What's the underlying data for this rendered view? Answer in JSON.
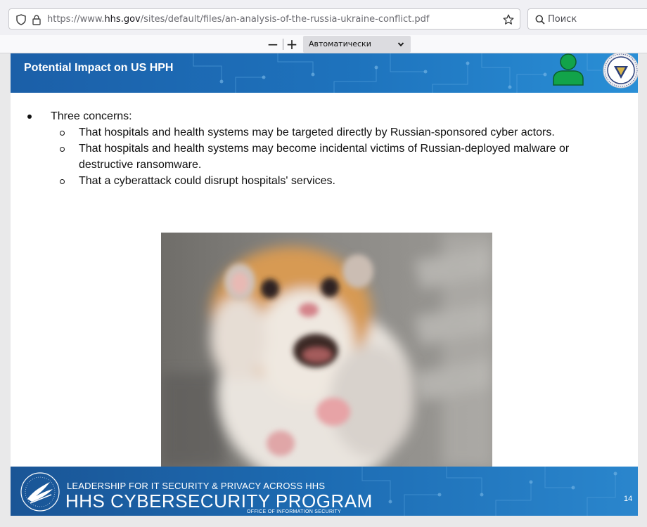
{
  "browser": {
    "url_prefix": "https://www.",
    "url_domain": "hhs.gov",
    "url_path": "/sites/default/files/an-analysis-of-the-russia-ukraine-conflict.pdf",
    "search_placeholder": "Поиск"
  },
  "pdf_toolbar": {
    "zoom_out_label": "−",
    "zoom_in_label": "+",
    "zoom_value": "Автоматически"
  },
  "slide": {
    "title": "Potential Impact on US HPH",
    "bullet_main": "Three concerns:",
    "sub_bullets": [
      "That hospitals and health systems may be targeted directly by Russian-sponsored cyber actors.",
      "That hospitals and health systems may become incidental victims of Russian-deployed malware or destructive ransomware.",
      "That a cyberattack could disrupt hospitals' services."
    ],
    "footer_line1": "LEADERSHIP FOR IT SECURITY & PRIVACY ACROSS HHS",
    "footer_line2": "HHS CYBERSECURITY PROGRAM",
    "footer_line3": "OFFICE OF INFORMATION SECURITY",
    "page_number": "14"
  },
  "colors": {
    "header_blue": "#1e73bd",
    "footer_blue": "#1d6cb3",
    "user_icon_green": "#12a34a"
  },
  "icons": [
    "shield-icon",
    "lock-icon",
    "bookmark-star-icon",
    "search-icon",
    "chevron-down-icon",
    "user-icon",
    "hhs-seal-icon",
    "hhs-eagle-logo"
  ]
}
